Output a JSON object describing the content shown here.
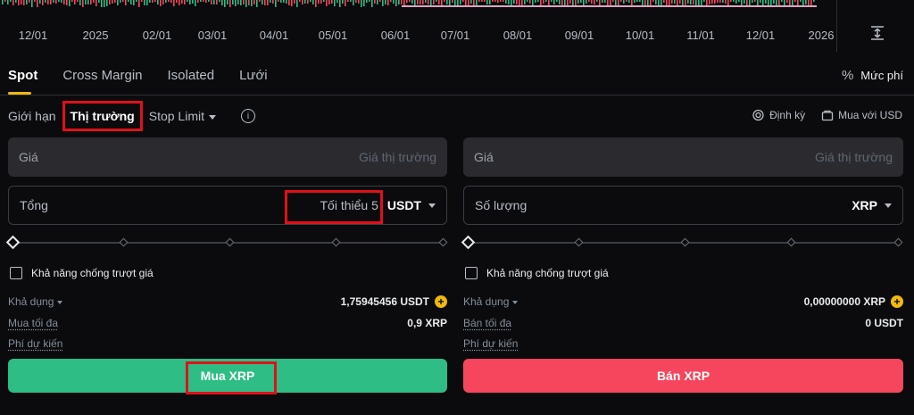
{
  "chart": {
    "axis": [
      "12/01",
      "2025",
      "02/01",
      "03/01",
      "04/01",
      "05/01",
      "06/01",
      "07/01",
      "08/01",
      "09/01",
      "10/01",
      "11/01",
      "12/01",
      "2026"
    ],
    "icon": "expand-vertical-icon"
  },
  "tabs": [
    {
      "label": "Spot",
      "active": true
    },
    {
      "label": "Cross Margin",
      "active": false
    },
    {
      "label": "Isolated",
      "active": false
    },
    {
      "label": "Lưới",
      "active": false
    }
  ],
  "fee": {
    "icon": "percent-icon",
    "label": "Mức phí"
  },
  "order_types": {
    "limit": "Giới hạn",
    "market": "Thị trường",
    "stop_limit": "Stop Limit"
  },
  "right_links": {
    "recurring": "Định kỳ",
    "buy_usd": "Mua với USD"
  },
  "buy": {
    "price_label": "Giá",
    "price_placeholder": "Giá thị trường",
    "total_label": "Tổng",
    "total_placeholder": "Tối thiểu 5",
    "total_unit": "USDT",
    "slippage_label": "Khả năng chống trượt giá",
    "available_label": "Khả dụng",
    "available_value": "1,75945456 USDT",
    "max_label": "Mua tối đa",
    "max_value": "0,9 XRP",
    "fee_label": "Phí dự kiến",
    "button": "Mua XRP"
  },
  "sell": {
    "price_label": "Giá",
    "price_placeholder": "Giá thị trường",
    "qty_label": "Số lượng",
    "qty_unit": "XRP",
    "slippage_label": "Khả năng chống trượt giá",
    "available_label": "Khả dụng",
    "available_value": "0,00000000 XRP",
    "max_label": "Bán tối đa",
    "max_value": "0 USDT",
    "fee_label": "Phí dự kiến",
    "button": "Bán XRP"
  },
  "colors": {
    "accent": "#f0b90b",
    "buy": "#2ebd85",
    "sell": "#f6465d",
    "highlight": "#e0101a"
  }
}
